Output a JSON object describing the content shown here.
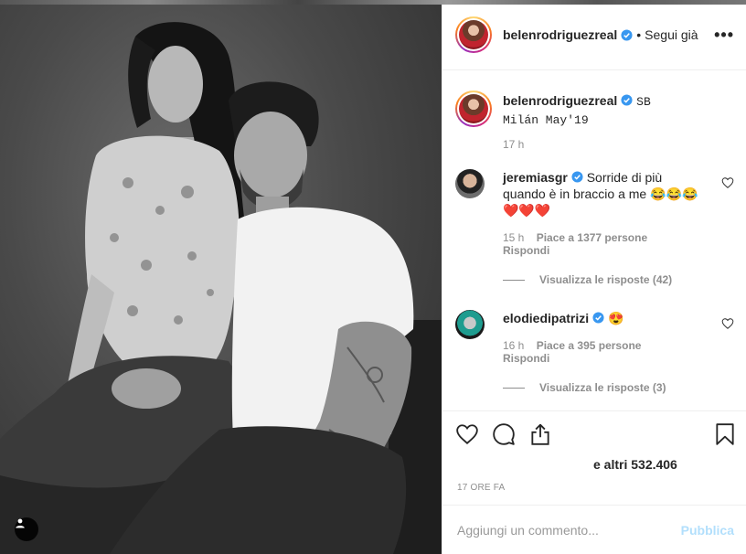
{
  "post": {
    "username": "belenrodriguezreal",
    "follow_separator": "•",
    "follow_label": "Segui già",
    "more_label": "•••"
  },
  "caption": {
    "username": "belenrodriguezreal",
    "text_line1": "SB",
    "text_line2": "Milán May'19",
    "age": "17 h"
  },
  "comments": [
    {
      "username": "jeremiasgr",
      "text_line1": "Sorride di più",
      "text_line2": "quando è in braccio a me 😂😂😂",
      "text_line3": "❤️❤️❤️",
      "age": "15 h",
      "likes": "Piace a 1377 persone",
      "reply_label": "Rispondi",
      "view_replies": "Visualizza le risposte (42)"
    },
    {
      "username": "elodiedipatrizi",
      "text_line1": "😍",
      "age": "16 h",
      "likes": "Piace a 395 persone",
      "reply_label": "Rispondi",
      "view_replies": "Visualizza le risposte (3)"
    }
  ],
  "actions": {
    "likes_text": "e altri 532.406",
    "timestamp": "17 ORE FA"
  },
  "add_comment": {
    "placeholder": "Aggiungi un commento...",
    "publish_label": "Pubblica"
  },
  "icons": {
    "verified": "verified-badge-icon",
    "heart": "heart-icon",
    "comment": "comment-icon",
    "share": "share-icon",
    "bookmark": "bookmark-icon",
    "tag": "user-tag-icon"
  },
  "colors": {
    "verified_blue": "#3897f0",
    "publish_disabled": "#b2dffc",
    "meta_grey": "#8e8e8e"
  }
}
